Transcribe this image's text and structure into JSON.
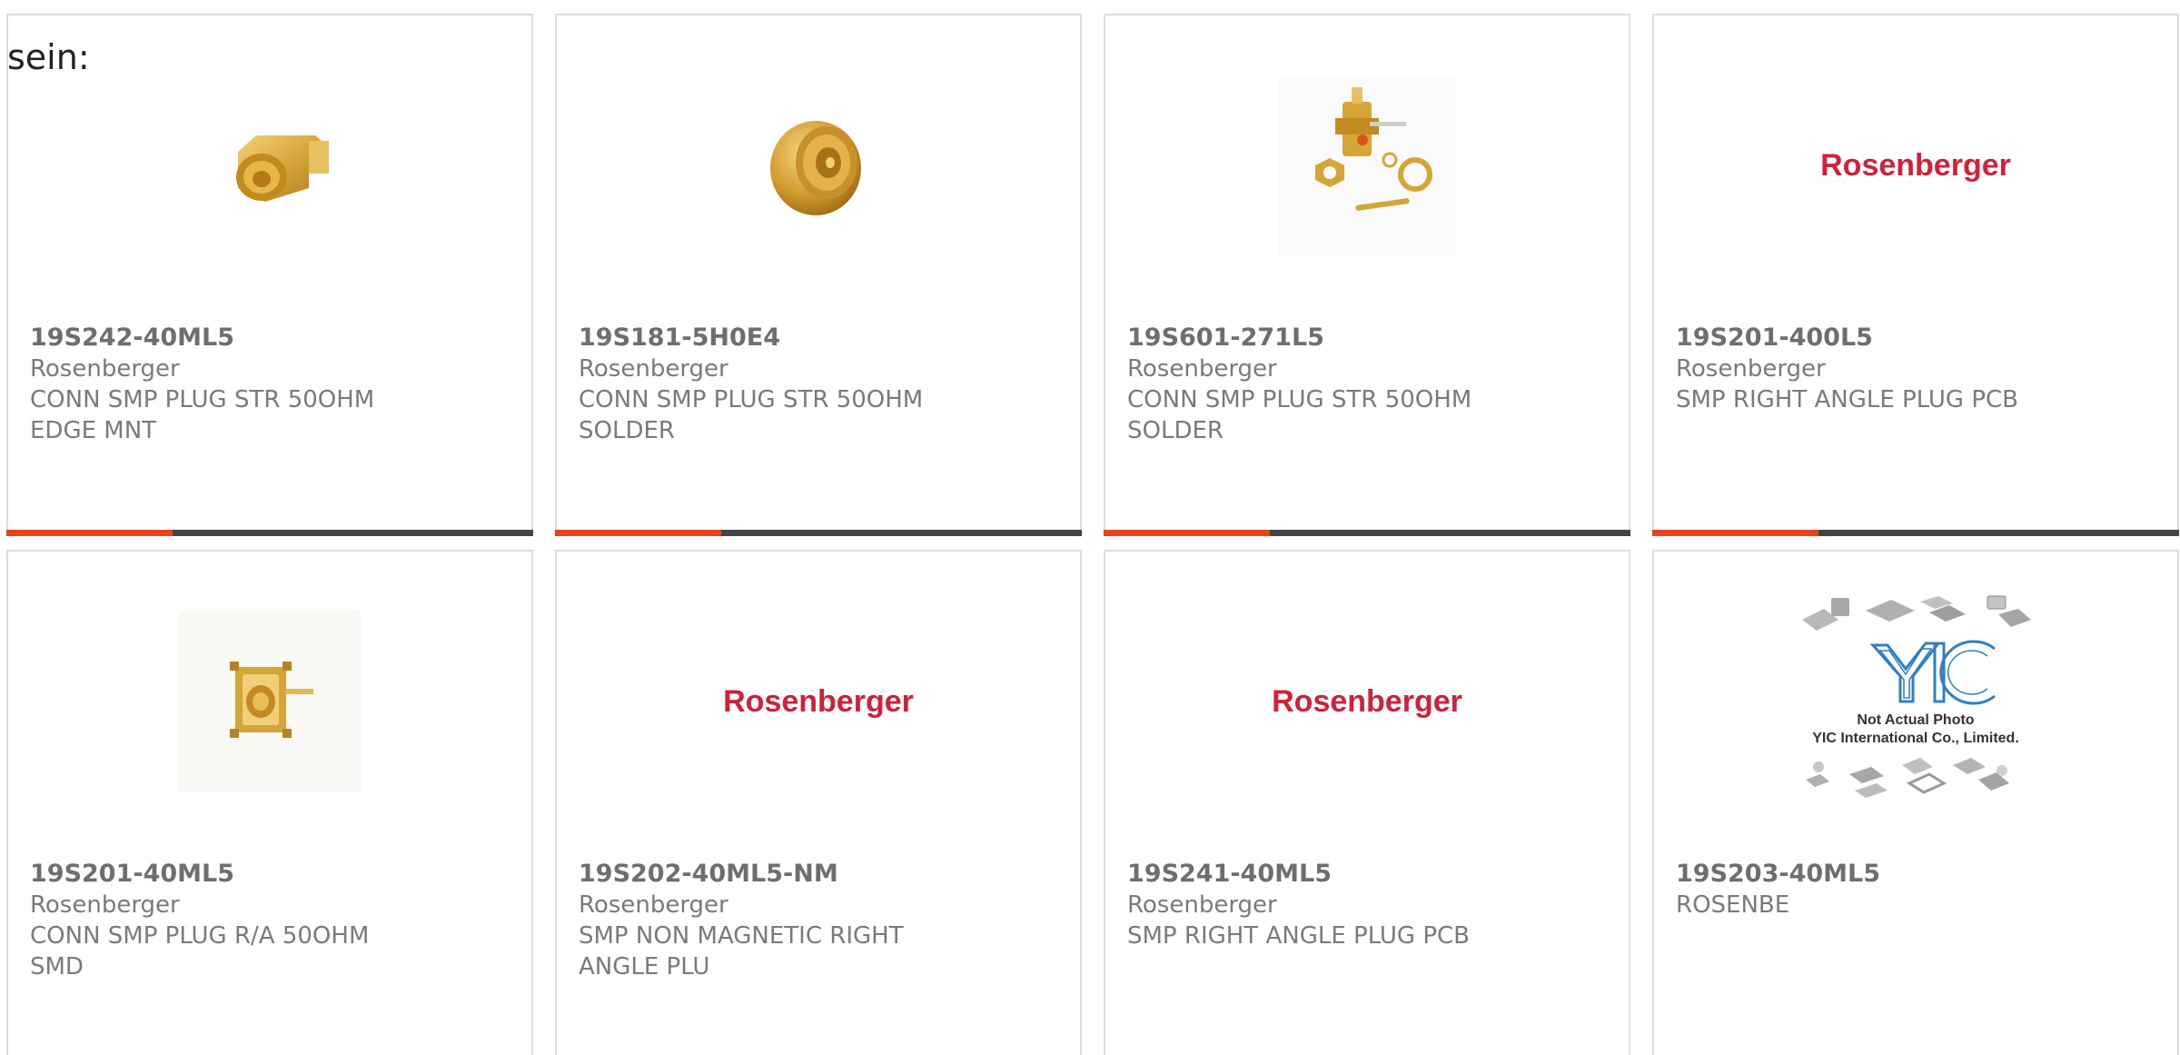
{
  "intro_text": "sein:",
  "colors": {
    "accent": "#e8421a",
    "bar": "#444444",
    "brand_red": "#d3203a",
    "gold": "#d6a538"
  },
  "products": [
    {
      "part_number": "19S242-40ML5",
      "manufacturer": "Rosenberger",
      "description": "CONN SMP PLUG STR 50OHM EDGE MNT",
      "image": "edge-mount-connector-photo"
    },
    {
      "part_number": "19S181-5H0E4",
      "manufacturer": "Rosenberger",
      "description": "CONN SMP PLUG STR 50OHM SOLDER",
      "image": "round-connector-photo"
    },
    {
      "part_number": "19S601-271L5",
      "manufacturer": "Rosenberger",
      "description": "CONN SMP PLUG STR 50OHM SOLDER",
      "image": "connector-kit-photo"
    },
    {
      "part_number": "19S201-400L5",
      "manufacturer": "Rosenberger",
      "description": "SMP RIGHT ANGLE PLUG PCB",
      "image": "rosenberger-logo",
      "logo_text": "Rosenberger"
    },
    {
      "part_number": "19S201-40ML5",
      "manufacturer": "Rosenberger",
      "description": "CONN SMP PLUG R/A 50OHM SMD",
      "image": "smd-connector-photo"
    },
    {
      "part_number": "19S202-40ML5-NM",
      "manufacturer": "Rosenberger",
      "description": "SMP NON MAGNETIC RIGHT ANGLE PLU",
      "image": "rosenberger-logo",
      "logo_text": "Rosenberger"
    },
    {
      "part_number": "19S241-40ML5",
      "manufacturer": "Rosenberger",
      "description": "SMP RIGHT ANGLE PLUG PCB",
      "image": "rosenberger-logo",
      "logo_text": "Rosenberger"
    },
    {
      "part_number": "19S203-40ML5",
      "manufacturer": "ROSENBE",
      "description": "",
      "image": "not-actual-photo-placeholder",
      "placeholder_line1": "Not Actual Photo",
      "placeholder_line2": "YIC International Co., Limited."
    }
  ]
}
